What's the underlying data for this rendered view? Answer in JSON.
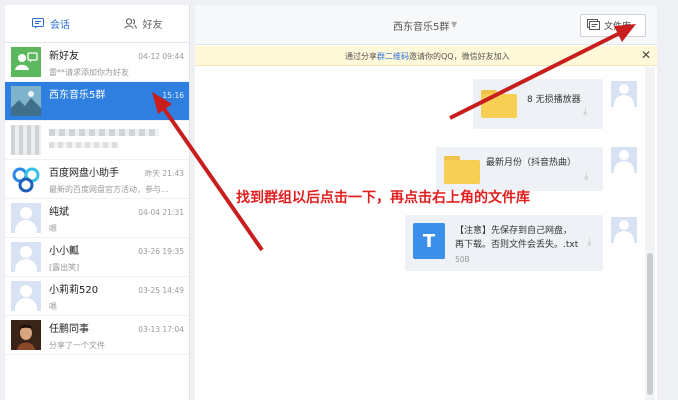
{
  "left_panel": {
    "tabs": [
      {
        "label": "会话",
        "icon": "chat-icon"
      },
      {
        "label": "好友",
        "icon": "friends-icon"
      }
    ],
    "conversations": [
      {
        "name": "新好友",
        "time": "04-12 09:44",
        "subtitle": "雷**请求添加你为好友"
      },
      {
        "name": "西东音乐5群",
        "time": "15:16",
        "subtitle": ""
      },
      {
        "name": "",
        "time": "",
        "subtitle": ""
      },
      {
        "name": "百度网盘小助手",
        "time": "昨天 21:43",
        "subtitle": "最新的百度网盘官方活动，参与..."
      },
      {
        "name": "纯斌",
        "time": "04-04 21:31",
        "subtitle": "嗯"
      },
      {
        "name": "小小瓤",
        "time": "03-26 19:35",
        "subtitle": "[露出笑]"
      },
      {
        "name": "小莉莉520",
        "time": "03-25 14:49",
        "subtitle": "嗯"
      },
      {
        "name": "任鹏同事",
        "time": "03-13 17:04",
        "subtitle": "分享了一个文件"
      }
    ]
  },
  "chat": {
    "title": "西东音乐5群",
    "file_library_label": "文件库",
    "notice": {
      "prefix": "通过分享",
      "link": "群二维码",
      "suffix": "邀请你的QQ，微信好友加入"
    },
    "messages": [
      {
        "file_name": "8 无损播放器",
        "type": "folder"
      },
      {
        "file_name": "最新月份（抖音热曲）",
        "type": "folder"
      },
      {
        "file_name_line1": "【注意】先保存到自己网盘，",
        "file_name_line2": "再下载。否则文件会丢失。.txt",
        "size": "50B",
        "type": "txt",
        "icon_letter": "T"
      }
    ]
  },
  "annotation": {
    "text": "找到群组以后点击一下，再点击右上角的文件库",
    "color": "#e02020"
  },
  "colors": {
    "accent": "#2f7fe0",
    "folder": "#f7cf55",
    "txt_icon": "#3b8eea"
  }
}
